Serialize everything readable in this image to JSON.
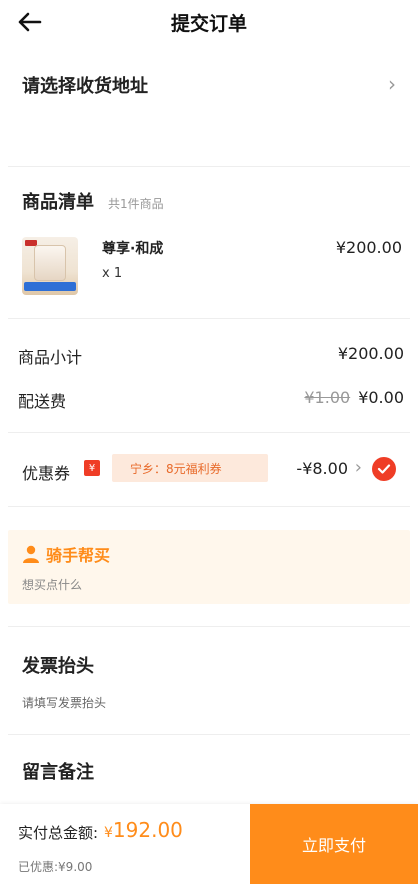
{
  "header": {
    "title": "提交订单"
  },
  "address": {
    "label": "请选择收货地址"
  },
  "goods": {
    "title": "商品清单",
    "count_text": "共1件商品",
    "items": [
      {
        "name": "尊享·和成",
        "qty": "x 1",
        "price": "¥200.00"
      }
    ]
  },
  "fees": {
    "subtotal_label": "商品小计",
    "subtotal_value": "¥200.00",
    "delivery_label": "配送费",
    "delivery_original": "¥1.00",
    "delivery_value": "¥0.00"
  },
  "coupon": {
    "label": "优惠券",
    "badge": "¥",
    "name": "宁乡：8元福利券",
    "amount": "-¥8.00",
    "checked": true
  },
  "rider": {
    "title": "骑手帮买",
    "placeholder": "想买点什么"
  },
  "invoice": {
    "title": "发票抬头",
    "placeholder": "请填写发票抬头"
  },
  "remark": {
    "title": "留言备注"
  },
  "footer": {
    "total_label": "实付总金额:",
    "currency": "¥",
    "total_value": "192.00",
    "saved": "已优惠:¥9.00",
    "pay_label": "立即支付"
  },
  "colors": {
    "accent": "#ff8c1a",
    "red": "#ef3d26",
    "coupon_bg": "#fde9dc",
    "rider_bg": "#fff7ec"
  }
}
